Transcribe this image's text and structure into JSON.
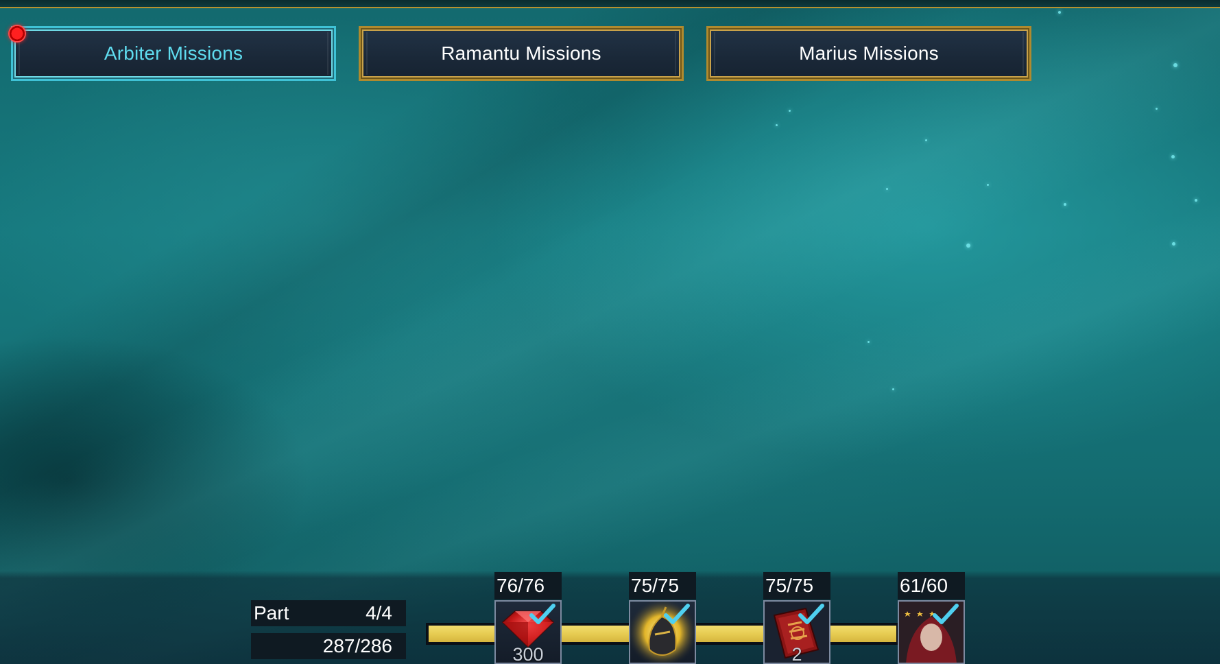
{
  "tabs": [
    {
      "label": "Arbiter Missions",
      "active": true,
      "has_notification": true
    },
    {
      "label": "Ramantu Missions",
      "active": false,
      "has_notification": false
    },
    {
      "label": "Marius Missions",
      "active": false,
      "has_notification": false
    }
  ],
  "progress": {
    "part_label": "Part",
    "part_value": "4/4",
    "points_value": "287/286",
    "fill_fraction": 1.0
  },
  "milestones": [
    {
      "label": "76/76",
      "reward": "ruby-gem-icon",
      "quantity": "300",
      "completed": true
    },
    {
      "label": "75/75",
      "reward": "helmet-artifact-icon",
      "quantity": "",
      "completed": true
    },
    {
      "label": "75/75",
      "reward": "tome-icon",
      "quantity": "2",
      "completed": true
    },
    {
      "label": "61/60",
      "reward": "champion-portrait-icon",
      "quantity": "",
      "completed": true
    }
  ],
  "colors": {
    "active_tab": "#3fc2d6",
    "inactive_tab_border": "#b08a2e",
    "progress_fill": "#e7cc52",
    "check": "#4fd0f0",
    "notification": "#ff2020"
  }
}
